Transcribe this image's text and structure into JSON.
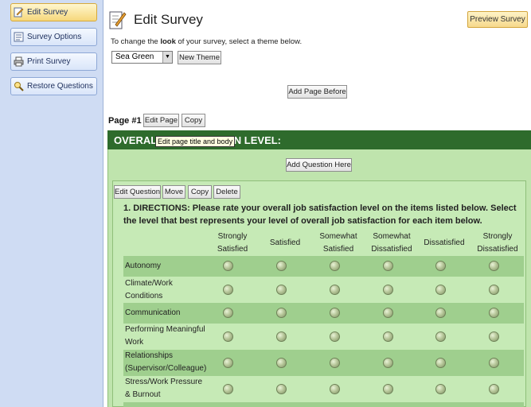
{
  "sidebar": {
    "items": [
      {
        "label": "Edit Survey",
        "icon": "edit-icon",
        "active": true
      },
      {
        "label": "Survey Options",
        "icon": "options-icon",
        "active": false
      },
      {
        "label": "Print Survey",
        "icon": "printer-icon",
        "active": false
      },
      {
        "label": "Restore Questions",
        "icon": "restore-icon",
        "active": false
      }
    ]
  },
  "header": {
    "title": "Edit Survey",
    "preview_label": "Preview Survey",
    "theme_hint_pre": "To change the ",
    "theme_hint_bold": "look",
    "theme_hint_post": " of your survey, select a theme below.",
    "theme_value": "Sea Green",
    "new_theme_label": "New Theme"
  },
  "page": {
    "add_page_before_label": "Add Page Before",
    "page_label": "Page #1",
    "edit_page_label": "Edit Page",
    "copy_label": "Copy",
    "header_text_left": "OVERALL",
    "header_text_right": "TION LEVEL:",
    "tooltip": "Edit page title and body",
    "add_question_label": "Add Question Here"
  },
  "question": {
    "toolbar": {
      "edit": "Edit Question",
      "move": "Move",
      "copy": "Copy",
      "delete": "Delete"
    },
    "text": "1. DIRECTIONS: Please rate your overall job satisfaction level on the items listed below. Select the level that best represents your level of overall job satisfaction for each item below.",
    "columns": [
      [
        "Strongly",
        "Satisfied"
      ],
      [
        "Satisfied"
      ],
      [
        "Somewhat",
        "Satisfied"
      ],
      [
        "Somewhat",
        "Dissatisfied"
      ],
      [
        "Dissatisfied"
      ],
      [
        "Strongly",
        "Dissatisfied"
      ]
    ],
    "rows": [
      [
        "Autonomy"
      ],
      [
        "Climate/Work",
        "Conditions"
      ],
      [
        "Communication"
      ],
      [
        "Performing Meaningful",
        "Work"
      ],
      [
        "Relationships",
        "(Supervisor/Colleague)"
      ],
      [
        "Stress/Work Pressure",
        "& Burnout"
      ]
    ]
  },
  "colors": {
    "page_header_bg": "#2e6b2c",
    "page_body_bg": "#bfe4ad",
    "row_shade": "#9fcf8e",
    "sidebar_bg": "#cfdcf3",
    "active_tab": "#f6d77b"
  }
}
